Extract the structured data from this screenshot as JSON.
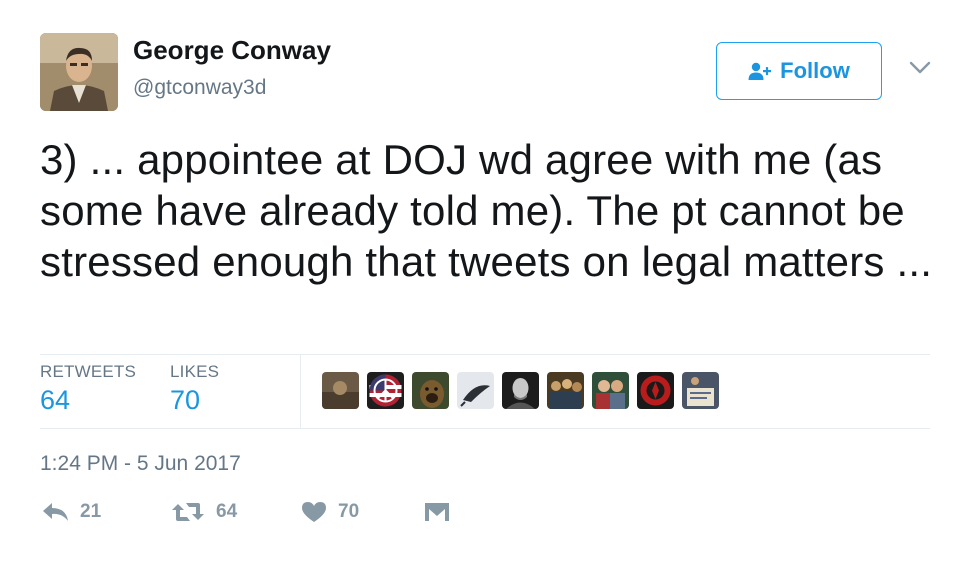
{
  "author": {
    "name": "George Conway",
    "handle": "@gtconway3d",
    "avatar_icon": "profile-portrait"
  },
  "follow_button": {
    "label": "Follow",
    "icon": "add-user-icon",
    "color": "#1da1f2"
  },
  "menu": {
    "icon": "chevron-down-icon"
  },
  "tweet": {
    "text": "3) ... appointee at DOJ wd agree with me (as some have already told me). The pt cannot be stressed enough that tweets on legal matters ..."
  },
  "stats": {
    "retweets_label": "RETWEETS",
    "retweets_value": "64",
    "likes_label": "LIKES",
    "likes_value": "70"
  },
  "likers": [
    {
      "icon": "avatar-1",
      "color": "#6b5a45"
    },
    {
      "icon": "avatar-2-peace-flag",
      "color": "#3a4f8a"
    },
    {
      "icon": "avatar-3-dog",
      "color": "#7a5a2f"
    },
    {
      "icon": "avatar-4-feather",
      "color": "#d9dde3"
    },
    {
      "icon": "avatar-5-portrait",
      "color": "#3c3c3c"
    },
    {
      "icon": "avatar-6-group",
      "color": "#6a5532"
    },
    {
      "icon": "avatar-7-group",
      "color": "#8a2e2e"
    },
    {
      "icon": "avatar-8-red-emblem",
      "color": "#b81c1c"
    },
    {
      "icon": "avatar-9-sign",
      "color": "#4a5568"
    }
  ],
  "timestamp": "1:24 PM - 5 Jun 2017",
  "actions": {
    "reply": {
      "icon": "reply-icon",
      "count": "21"
    },
    "retweet": {
      "icon": "retweet-icon",
      "count": "64"
    },
    "like": {
      "icon": "heart-icon",
      "count": "70"
    },
    "dm": {
      "icon": "envelope-icon"
    }
  },
  "colors": {
    "accent": "#1da1f2",
    "link_blue": "#1b95e0",
    "muted": "#657786",
    "icon_gray": "#8899a6"
  }
}
